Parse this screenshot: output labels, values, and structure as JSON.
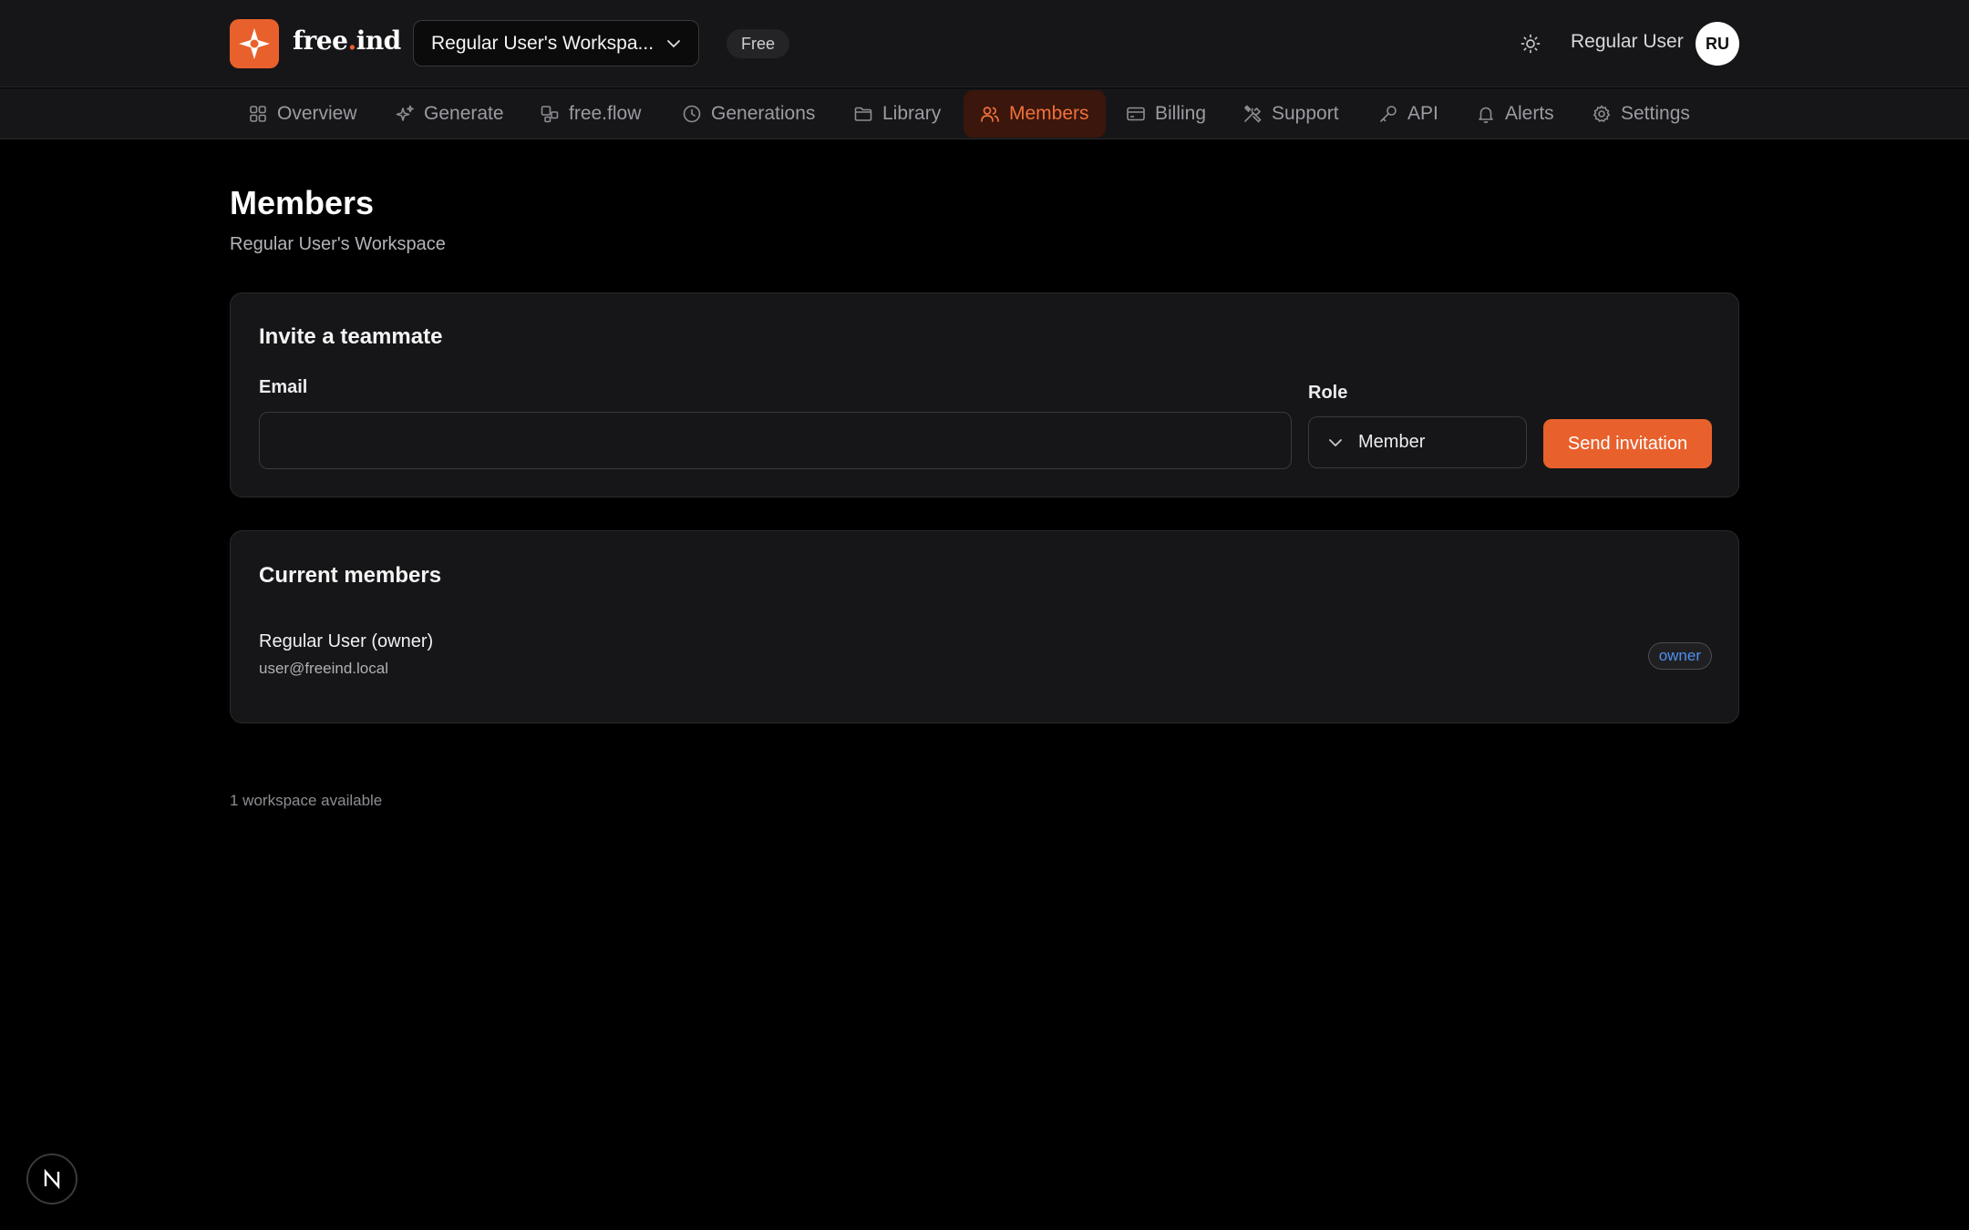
{
  "brand": {
    "name_prefix": "free",
    "name_dot": ".",
    "name_suffix": "ind"
  },
  "header": {
    "workspace_label": "Regular User's Workspa...",
    "plan": "Free",
    "user_name": "Regular User",
    "avatar_initials": "RU"
  },
  "nav": {
    "items": [
      {
        "label": "Overview",
        "icon": "grid-icon"
      },
      {
        "label": "Generate",
        "icon": "sparkle-icon"
      },
      {
        "label": "free.flow",
        "icon": "flow-icon"
      },
      {
        "label": "Generations",
        "icon": "clock-icon"
      },
      {
        "label": "Library",
        "icon": "folder-icon"
      },
      {
        "label": "Members",
        "icon": "users-icon",
        "active": true
      },
      {
        "label": "Billing",
        "icon": "credit-card-icon"
      },
      {
        "label": "Support",
        "icon": "tools-icon"
      },
      {
        "label": "API",
        "icon": "key-icon"
      },
      {
        "label": "Alerts",
        "icon": "bell-icon"
      },
      {
        "label": "Settings",
        "icon": "gear-icon"
      }
    ]
  },
  "page": {
    "title": "Members",
    "subtitle": "Regular User's Workspace"
  },
  "invite": {
    "title": "Invite a teammate",
    "email_label": "Email",
    "email_value": "",
    "role_label": "Role",
    "role_value": "Member",
    "send_label": "Send invitation"
  },
  "members": {
    "title": "Current members",
    "list": [
      {
        "name": "Regular User (owner)",
        "email": "user@freeind.local",
        "role": "owner"
      }
    ]
  },
  "footer": {
    "note": "1 workspace available"
  },
  "dev_badge": {
    "letter": "N"
  },
  "colors": {
    "accent": "#e8612c",
    "background": "#000000",
    "surface": "#161618",
    "role_badge_text": "#4f8ff0"
  }
}
